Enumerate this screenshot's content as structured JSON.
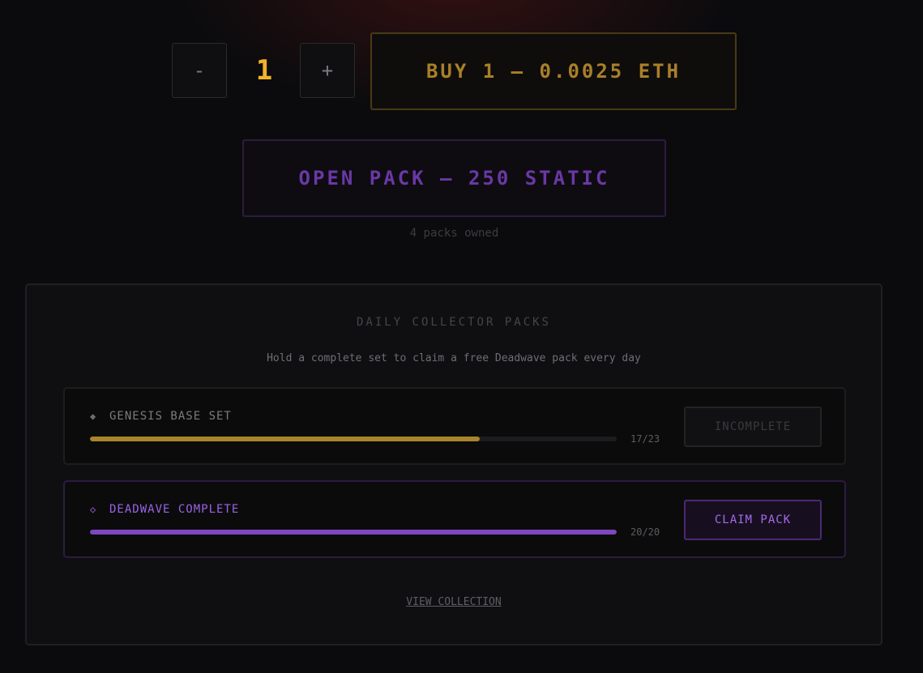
{
  "quantity": {
    "minus_label": "-",
    "value": "1",
    "plus_label": "+"
  },
  "buy_button": {
    "label": "BUY 1 — 0.0025 ETH"
  },
  "open_pack_button": {
    "label": "OPEN PACK — 250 STATIC"
  },
  "packs_owned_text": "4 packs owned",
  "daily_packs": {
    "title": "DAILY COLLECTOR PACKS",
    "subtitle": "Hold a complete set to claim a free Deadwave pack every day",
    "sets": [
      {
        "icon": "filled-diamond-icon",
        "icon_glyph": "◆",
        "name": "GENESIS BASE SET",
        "owned": 17,
        "total": 23,
        "count_text": "17/23",
        "progress": 0.74,
        "bar_color": "#a8842a",
        "button_label": "INCOMPLETE"
      },
      {
        "icon": "outline-diamond-icon",
        "icon_glyph": "◇",
        "name": "DEADWAVE COMPLETE",
        "owned": 20,
        "total": 20,
        "count_text": "20/20",
        "progress": 1.0,
        "bar_color": "#7e47c0",
        "button_label": "CLAIM PACK"
      }
    ],
    "view_collection_label": "VIEW COLLECTION"
  },
  "colors": {
    "gold_accent": "#f0b429",
    "purple_accent": "#9c62e6",
    "background": "#0b0b0d"
  }
}
